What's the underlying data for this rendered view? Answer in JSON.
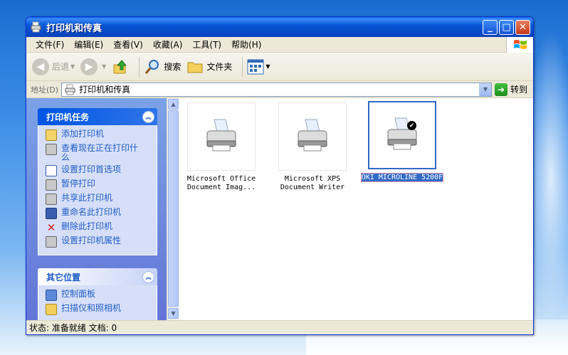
{
  "window": {
    "title": "打印机和传真",
    "minimize_label": "_",
    "maximize_label": "□",
    "close_label": "✕"
  },
  "menubar": {
    "items": [
      "文件(F)",
      "编辑(E)",
      "查看(V)",
      "收藏(A)",
      "工具(T)",
      "帮助(H)"
    ]
  },
  "toolbar": {
    "back_label": "后退",
    "search_label": "搜索",
    "folders_label": "文件夹"
  },
  "address": {
    "label": "地址(D)",
    "value": "打印机和传真",
    "go_label": "转到"
  },
  "taskpane": {
    "printer_tasks": {
      "title": "打印机任务",
      "items": [
        "添加打印机",
        "查看现在正在打印什么",
        "设置打印首选项",
        "暂停打印",
        "共享此打印机",
        "重命名此打印机",
        "删除此打印机",
        "设置打印机属性"
      ]
    },
    "other_places": {
      "title": "其它位置",
      "items": [
        "控制面板",
        "扫描仪和照相机"
      ]
    }
  },
  "files": [
    {
      "line1": "Microsoft Office",
      "line2": "Document Imag...",
      "selected": false,
      "default": false
    },
    {
      "line1": "Microsoft XPS",
      "line2": "Document Writer",
      "selected": false,
      "default": false
    },
    {
      "line1": "OKI MICROLINE 5200F",
      "line2": "",
      "selected": true,
      "default": true
    }
  ],
  "status": {
    "text": "状态: 准备就绪 文档: 0"
  }
}
